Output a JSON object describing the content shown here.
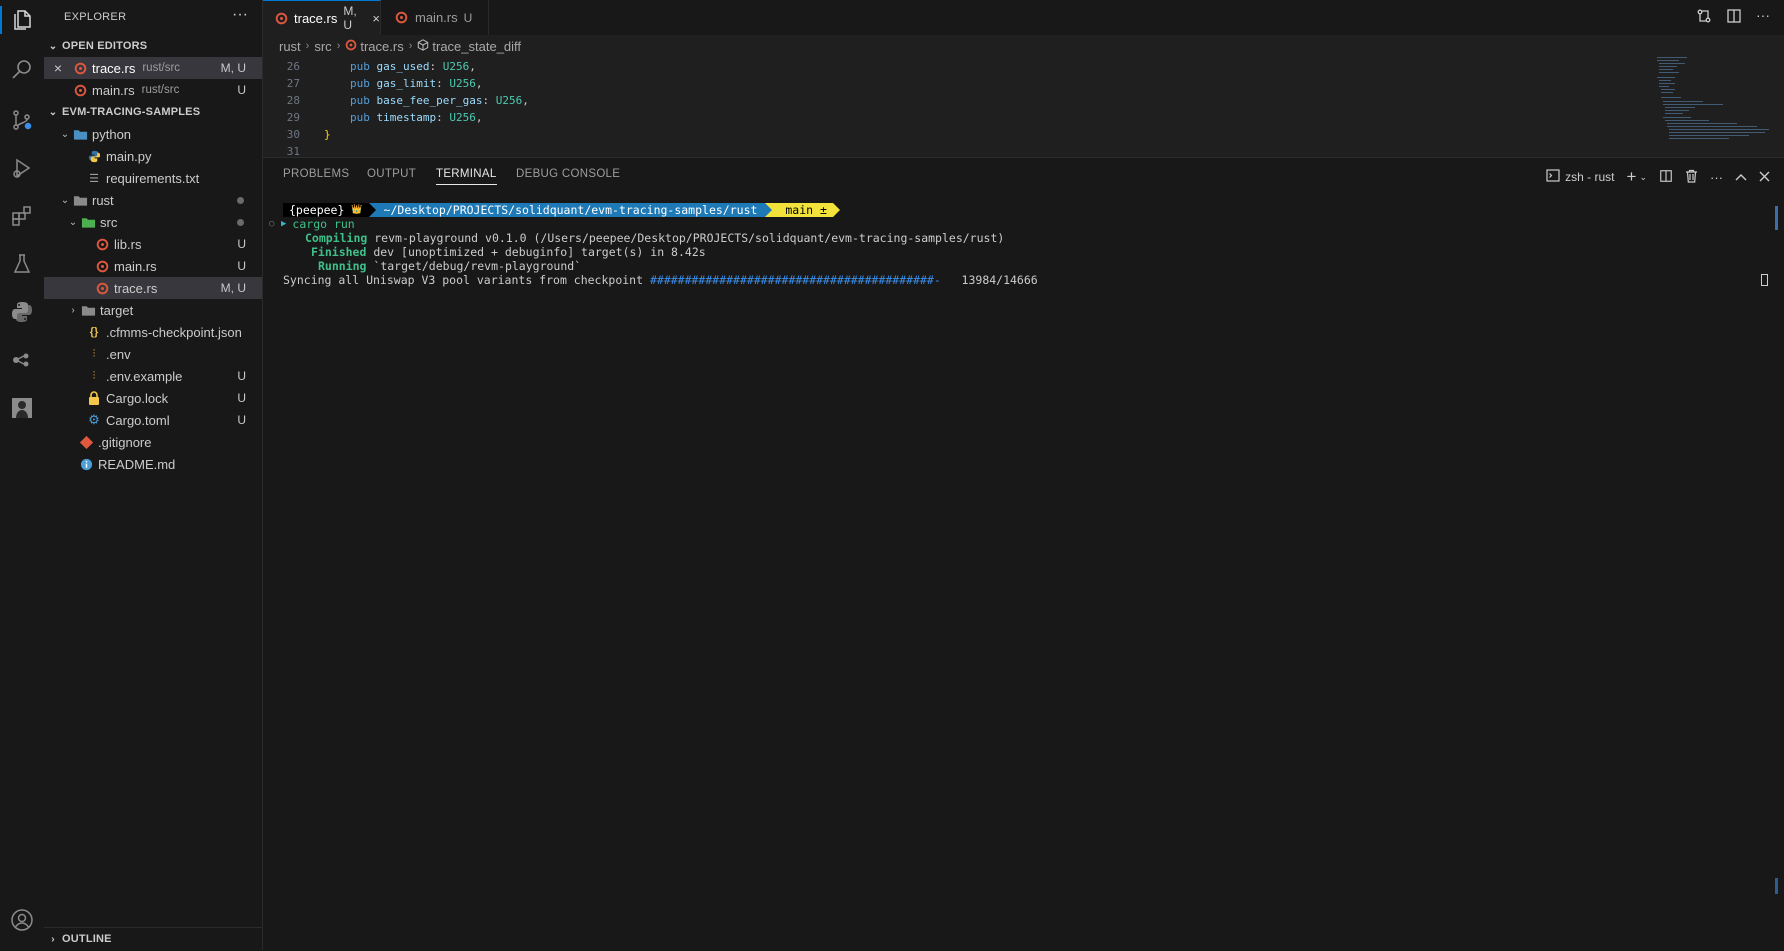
{
  "activity_bar": {
    "icons": [
      "explorer-icon",
      "search-icon",
      "source-control-icon",
      "run-debug-icon",
      "extensions-icon",
      "testing-icon",
      "python-icon",
      "remote-explorer-icon",
      "custom-extension-icon",
      "account-icon"
    ]
  },
  "sidebar": {
    "title": "EXPLORER",
    "more": "···",
    "open_editors": {
      "label": "OPEN EDITORS",
      "items": [
        {
          "name": "trace.rs",
          "desc": "rust/src",
          "badge": "M, U"
        },
        {
          "name": "main.rs",
          "desc": "rust/src",
          "badge": "U"
        }
      ]
    },
    "project": {
      "label": "EVM-TRACING-SAMPLES",
      "tree": [
        {
          "name": "python"
        },
        {
          "name": "main.py"
        },
        {
          "name": "requirements.txt"
        },
        {
          "name": "rust"
        },
        {
          "name": "src"
        },
        {
          "name": "lib.rs",
          "badge": "U"
        },
        {
          "name": "main.rs",
          "badge": "U"
        },
        {
          "name": "trace.rs",
          "badge": "M, U"
        },
        {
          "name": "target"
        },
        {
          "name": ".cfmms-checkpoint.json"
        },
        {
          "name": ".env"
        },
        {
          "name": ".env.example",
          "badge": "U"
        },
        {
          "name": "Cargo.lock",
          "badge": "U"
        },
        {
          "name": "Cargo.toml",
          "badge": "U"
        },
        {
          "name": ".gitignore"
        },
        {
          "name": "README.md"
        }
      ]
    },
    "outline_label": "OUTLINE"
  },
  "tabs": [
    {
      "label": "trace.rs",
      "status": "M, U",
      "close": "×"
    },
    {
      "label": "main.rs",
      "status": "U"
    }
  ],
  "breadcrumb": {
    "parts": [
      "rust",
      "src",
      "trace.rs",
      "trace_state_diff"
    ],
    "sep": "›"
  },
  "code": {
    "lines": [
      {
        "num": "26",
        "kw": "pub",
        "field": "gas_used",
        "colon": ":",
        "type": "U256",
        "end": ","
      },
      {
        "num": "27",
        "kw": "pub",
        "field": "gas_limit",
        "colon": ":",
        "type": "U256",
        "end": ","
      },
      {
        "num": "28",
        "kw": "pub",
        "field": "base_fee_per_gas",
        "colon": ":",
        "type": "U256",
        "end": ","
      },
      {
        "num": "29",
        "kw": "pub",
        "field": "timestamp",
        "colon": ":",
        "type": "U256",
        "end": ","
      },
      {
        "num": "30",
        "brace": "}"
      },
      {
        "num": "31"
      }
    ]
  },
  "panel": {
    "tabs": [
      "PROBLEMS",
      "OUTPUT",
      "TERMINAL",
      "DEBUG CONSOLE"
    ],
    "active_tab": "TERMINAL",
    "terminal_name": "zsh - rust",
    "add": "+",
    "more": "···"
  },
  "terminal": {
    "prompt_user": "{peepee}",
    "prompt_user_icon": "👑",
    "prompt_path": "~/Desktop/PROJECTS/solidquant/evm-tracing-samples/rust",
    "prompt_branch": " main ±",
    "command": "cargo run",
    "compiling_label": "Compiling",
    "compiling_text": "revm-playground v0.1.0 (/Users/peepee/Desktop/PROJECTS/solidquant/evm-tracing-samples/rust)",
    "finished_label": "Finished",
    "finished_text": "dev [unoptimized + debuginfo] target(s) in 8.42s",
    "running_label": "Running",
    "running_text": "`target/debug/revm-playground`",
    "sync_text": "Syncing all Uniswap V3 pool variants from checkpoint",
    "progress_bar": "#########################################-",
    "progress_count": "13984/14666"
  },
  "colors": {
    "accent": "#0078d4",
    "rust_icon": "#e0583e",
    "terminal_green": "#3fc08a",
    "prompt_path_bg": "#1e79b7",
    "prompt_git_bg": "#f2e23a"
  }
}
